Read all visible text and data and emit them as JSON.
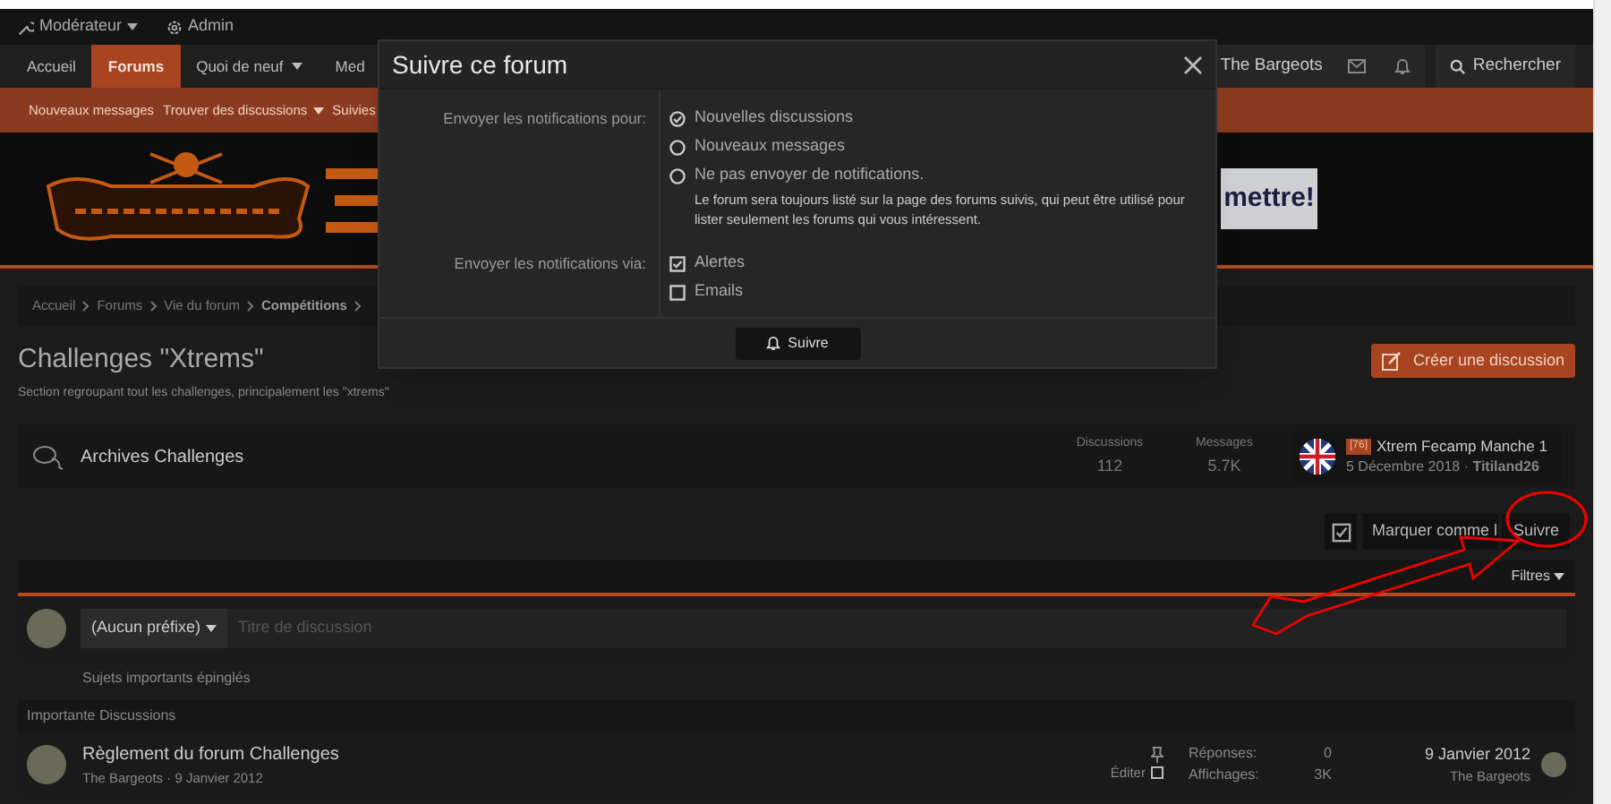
{
  "top_bar": [
    {
      "label": "Modérateur",
      "kind": "moderator",
      "dropdown": true
    },
    {
      "label": "Admin",
      "kind": "admin",
      "dropdown": false
    }
  ],
  "nav": {
    "tabs": [
      {
        "label": "Accueil",
        "selected": false,
        "dropdown": false
      },
      {
        "label": "Forums",
        "selected": true,
        "dropdown": false
      },
      {
        "label": "Quoi de neuf",
        "selected": false,
        "dropdown": true
      },
      {
        "label": "Med",
        "selected": false,
        "dropdown": false
      }
    ],
    "user": "The Bargeots",
    "search": "Rechercher"
  },
  "sub_nav": [
    {
      "label": "Nouveaux messages",
      "dropdown": false
    },
    {
      "label": "Trouver des discussions",
      "dropdown": true
    },
    {
      "label": "Suivies",
      "dropdown": false
    }
  ],
  "banner": {
    "side_text": "mettre!"
  },
  "breadcrumb": [
    {
      "label": "Accueil",
      "current": false
    },
    {
      "label": "Forums",
      "current": false
    },
    {
      "label": "Vie du forum",
      "current": false
    },
    {
      "label": "Compétitions",
      "current": true
    }
  ],
  "forum": {
    "title": "Challenges \"Xtrems\"",
    "description": "Section regroupant tout les challenges, principalement les \"xtrems\"",
    "create_button": "Créer une discussion"
  },
  "subforum": {
    "name": "Archives Challenges",
    "stats": [
      {
        "label": "Discussions",
        "value": "112"
      },
      {
        "label": "Messages",
        "value": "5.7K"
      }
    ],
    "last_post": {
      "prefix": "[76]",
      "title": "Xtrem Fecamp Manche 1",
      "byline": "5 Décembre 2018 · **Titiland26**"
    }
  },
  "actions": {
    "mark_read": "Marquer comme l",
    "follow": "Suivre"
  },
  "filters": "Filtres",
  "quick_thread": {
    "prefix": "(Aucun préfixe)",
    "placeholder": "Titre de discussion"
  },
  "sticky_label": "Sujets importants épinglés",
  "section": "Importante Discussions",
  "threads": [
    {
      "title": "Règlement du forum Challenges",
      "byline": "The Bargeots · 9 Janvier 2012",
      "edit_label": "Éditer",
      "edit_checked": false,
      "stats": [
        {
          "label": "Réponses:",
          "value": "0"
        },
        {
          "label": "Affichages:",
          "value": "3K"
        }
      ],
      "last_date": "9 Janvier 2012",
      "last_author": "The Bargeots"
    }
  ],
  "dialog": {
    "title": "Suivre ce forum",
    "groups": [
      {
        "label": "Envoyer les notifications pour:",
        "options": [
          {
            "kind": "radio",
            "label": "Nouvelles discussions",
            "selected": true
          },
          {
            "kind": "radio",
            "label": "Nouveaux messages",
            "selected": false
          },
          {
            "kind": "radio",
            "label": "Ne pas envoyer de notifications.",
            "selected": false,
            "hint": "Le forum sera toujours listé sur la page des forums suivis, qui peut être utilisé pour lister seulement les forums qui vous intéressent."
          }
        ]
      },
      {
        "label": "Envoyer les notifications via:",
        "options": [
          {
            "kind": "checkbox",
            "label": "Alertes",
            "checked": true
          },
          {
            "kind": "checkbox",
            "label": "Emails",
            "checked": false
          }
        ]
      }
    ],
    "button": "Suivre"
  }
}
